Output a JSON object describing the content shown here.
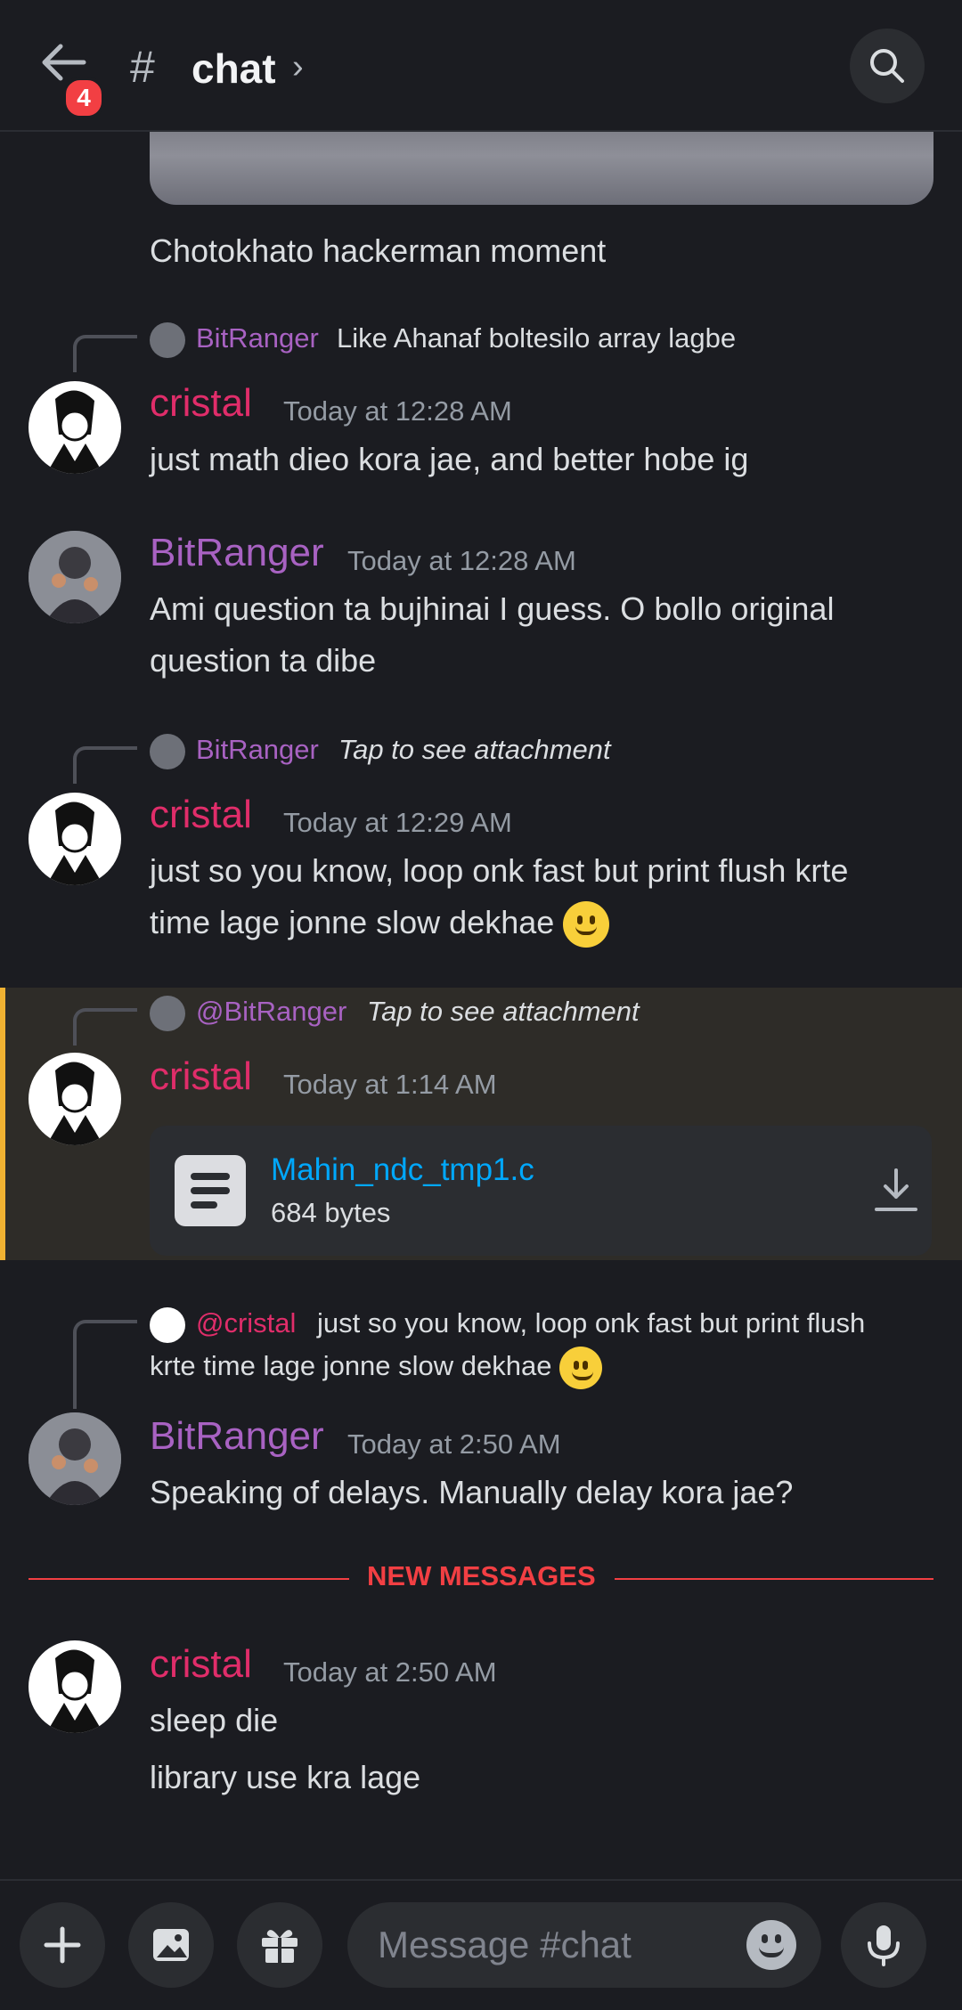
{
  "header": {
    "unread_badge": "4",
    "channel_hash": "#",
    "channel_name": "chat",
    "chevron": "›"
  },
  "feed": {
    "prev_caption": "Chotokhato hackerman moment",
    "messages": [
      {
        "reply": {
          "name": "BitRanger",
          "text": "Like Ahanaf boltesilo array lagbe"
        },
        "author": "cristal",
        "time": "Today at 12:28 AM",
        "lines": [
          "just math dieo kora jae, and better hobe ig"
        ]
      },
      {
        "author": "BitRanger",
        "time": "Today at 12:28 AM",
        "lines": [
          "Ami question ta bujhinai I guess. O bollo original",
          "question ta dibe"
        ]
      },
      {
        "reply": {
          "name": "BitRanger",
          "text": "Tap to see attachment"
        },
        "author": "cristal",
        "time": "Today at 12:29 AM",
        "lines": [
          "just so you know, loop onk fast but print flush krte",
          "time lage jonne slow dekhae"
        ]
      },
      {
        "reply": {
          "name": "@BitRanger",
          "text": "Tap to see attachment"
        },
        "author": "cristal",
        "time": "Today at 1:14 AM",
        "file": {
          "name": "Mahin_ndc_tmp1.c",
          "size": "684 bytes"
        }
      },
      {
        "reply": {
          "name": "@cristal",
          "text_line1": "just so you know, loop onk fast but print flush",
          "text_line2": "krte time lage jonne slow dekhae"
        },
        "author": "BitRanger",
        "time": "Today at 2:50 AM",
        "lines": [
          "Speaking of delays. Manually delay kora jae?"
        ]
      },
      {
        "author": "cristal",
        "time": "Today at 2:50 AM",
        "lines": [
          "sleep die",
          "library use kra lage"
        ]
      }
    ],
    "new_messages_label": "NEW MESSAGES"
  },
  "composer": {
    "placeholder": "Message #chat"
  },
  "icons": [
    "back-arrow-icon",
    "search-icon",
    "plus-icon",
    "image-icon",
    "gift-icon",
    "emoji-icon",
    "microphone-icon",
    "file-icon",
    "download-icon"
  ],
  "colors": {
    "background": "#1b1c21",
    "cristal_name": "#e02d6a",
    "bitranger_name": "#a862c2",
    "link": "#00a8fc",
    "new_messages": "#f23f43",
    "mention_highlight_bar": "#f0b232"
  }
}
